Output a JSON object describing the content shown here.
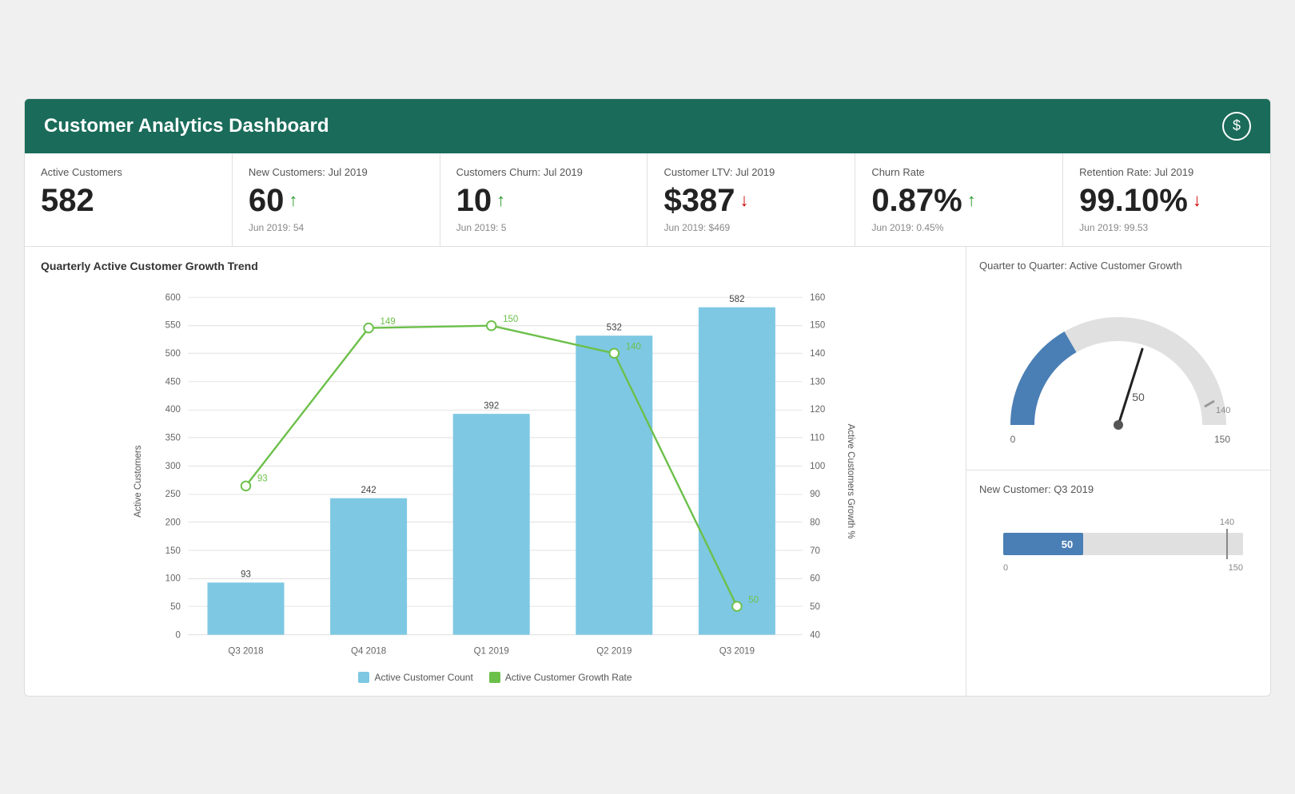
{
  "header": {
    "title": "Customer Analytics Dashboard",
    "icon": "$"
  },
  "kpis": [
    {
      "label": "Active Customers",
      "value": "582",
      "arrow": null,
      "sub": null
    },
    {
      "label": "New Customers: Jul 2019",
      "value": "60",
      "arrow": "up",
      "sub": "Jun 2019: 54"
    },
    {
      "label": "Customers Churn: Jul 2019",
      "value": "10",
      "arrow": "up",
      "sub": "Jun 2019: 5"
    },
    {
      "label": "Customer LTV: Jul 2019",
      "value": "$387",
      "arrow": "down",
      "sub": "Jun 2019: $469"
    },
    {
      "label": "Churn Rate",
      "value": "0.87%",
      "arrow": "up",
      "sub": "Jun 2019: 0.45%"
    },
    {
      "label": "Retention Rate: Jul 2019",
      "value": "99.10%",
      "arrow": "down",
      "sub": "Jun 2019: 99.53"
    }
  ],
  "bar_chart": {
    "title": "Quarterly Active Customer Growth Trend",
    "bars": [
      {
        "label": "Q3 2018",
        "value": 93,
        "growth": 93
      },
      {
        "label": "Q4 2018",
        "value": 242,
        "growth": 149
      },
      {
        "label": "Q1 2019",
        "value": 392,
        "growth": 150
      },
      {
        "label": "Q2 2019",
        "value": 532,
        "growth": 140
      },
      {
        "label": "Q3 2019",
        "value": 582,
        "growth": 50
      }
    ],
    "y_left_label": "Active Customers",
    "y_right_label": "Active Customers Growth %",
    "legend_bar": "Active Customer Count",
    "legend_line": "Active Customer Growth Rate"
  },
  "gauge": {
    "title": "Quarter to Quarter: Active Customer Growth",
    "value": 50,
    "min": 0,
    "max": 150,
    "mark": 140,
    "mark_label": "140"
  },
  "hbar": {
    "title": "New Customer: Q3 2019",
    "value": 50,
    "max": 150,
    "mark": 140,
    "min_label": "0",
    "max_label": "150"
  }
}
